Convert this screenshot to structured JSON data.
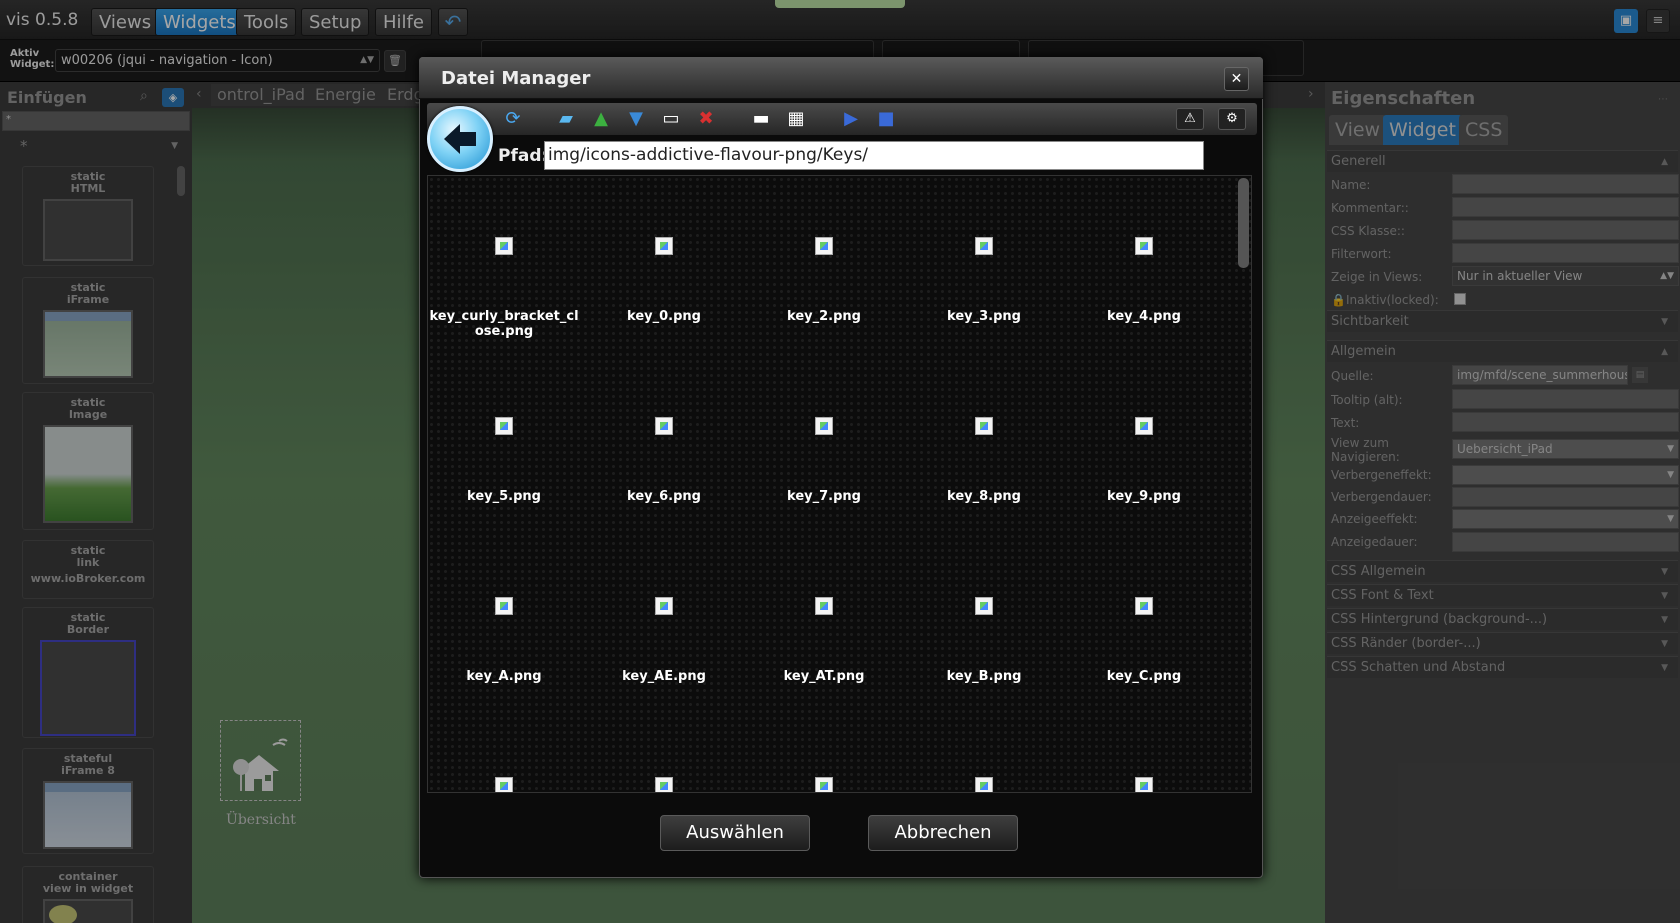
{
  "app": {
    "title": "vis 0.5.8"
  },
  "menu": [
    "Views",
    "Widgets",
    "Tools",
    "Setup",
    "Hilfe"
  ],
  "toolbar": {
    "aktiv_label_1": "Aktiv",
    "aktiv_label_2": "Widget:",
    "widget_select": "w00206 (jqui - navigation - Icon)"
  },
  "left_panel": {
    "title": "Einfügen",
    "filter_value": "*",
    "set_value": "*",
    "items": [
      {
        "type": "static",
        "name": "HTML"
      },
      {
        "type": "static",
        "name": "iFrame"
      },
      {
        "type": "static",
        "name": "Image"
      },
      {
        "type": "static",
        "name": "link",
        "extra": "www.ioBroker.com"
      },
      {
        "type": "static",
        "name": "Border"
      },
      {
        "type": "stateful",
        "name": "iFrame 8"
      },
      {
        "type": "container",
        "name": "view in widget"
      }
    ]
  },
  "view_tabs": [
    "ontrol_iPad",
    "Energie",
    "Erdg"
  ],
  "workarea": {
    "widget_label": "Übersicht"
  },
  "right_panel": {
    "title": "Eigenschaften",
    "tabs": [
      "View",
      "Widget",
      "CSS"
    ],
    "sections": {
      "generell": "Generell",
      "sichtbarkeit": "Sichtbarkeit",
      "allgemein": "Allgemein",
      "css_allgemein": "CSS Allgemein",
      "css_font": "CSS Font & Text",
      "css_hintergrund": "CSS Hintergrund (background-...)",
      "css_raender": "CSS Ränder (border-...)",
      "css_schatten": "CSS Schatten und Abstand"
    },
    "generell_fields": [
      {
        "label": "Name:",
        "value": ""
      },
      {
        "label": "Kommentar::",
        "value": ""
      },
      {
        "label": "CSS Klasse::",
        "value": ""
      },
      {
        "label": "Filterwort:",
        "value": ""
      },
      {
        "label": "Zeige in Views:",
        "value": "Nur in aktueller View"
      },
      {
        "label": "Inaktiv(locked):",
        "value": ""
      }
    ],
    "allgemein_fields": [
      {
        "label": "Quelle:",
        "value": "img/mfd/scene_summerhouse"
      },
      {
        "label": "Tooltip (alt):",
        "value": ""
      },
      {
        "label": "Text:",
        "value": ""
      },
      {
        "label": "View zum Navigieren:",
        "value": "Uebersicht_iPad"
      },
      {
        "label": "Verbergeneffekt:",
        "value": ""
      },
      {
        "label": "Verbergendauer:",
        "value": ""
      },
      {
        "label": "Anzeigeeffekt:",
        "value": ""
      },
      {
        "label": "Anzeigedauer:",
        "value": ""
      }
    ]
  },
  "dialog": {
    "title": "Datei Manager",
    "path_label": "Pfad:",
    "path_value": "img/icons-addictive-flavour-png/Keys/",
    "files": [
      "key_curly_bracket_close.png",
      "key_0.png",
      "key_2.png",
      "key_3.png",
      "key_4.png",
      "key_5.png",
      "key_6.png",
      "key_7.png",
      "key_8.png",
      "key_9.png",
      "key_A.png",
      "key_AE.png",
      "key_AT.png",
      "key_B.png",
      "key_C.png",
      "",
      "",
      "",
      "",
      ""
    ],
    "buttons": {
      "select": "Auswählen",
      "cancel": "Abbrechen"
    }
  },
  "colors": {
    "accent": "#2b8ad8",
    "dialog_bg": "#0b0b0b"
  }
}
